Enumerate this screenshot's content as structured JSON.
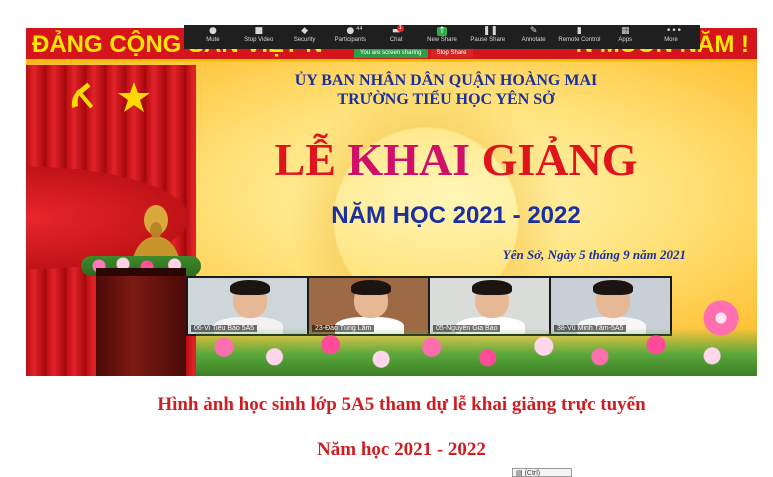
{
  "banner": {
    "slogan_left": "ĐẢNG CỘNG SẢN VIỆT N",
    "slogan_right": "N MUÔN NĂM !",
    "org": "ỦY BAN NHÂN DÂN QUẬN HOÀNG MAI",
    "school": "TRƯỜNG TIỂU HỌC YÊN SỞ",
    "title_w1": "LỄ ",
    "title_w2": "KHAI ",
    "title_w3": "GIẢNG",
    "year": "NĂM HỌC 2021 - 2022",
    "date": "Yên Sở, Ngày 5 tháng 9 năm 2021"
  },
  "zoom_toolbar": {
    "buttons": [
      {
        "label": "Mute",
        "icon": "microphone-icon",
        "glyph": "●"
      },
      {
        "label": "Stop Video",
        "icon": "video-camera-icon",
        "glyph": "■"
      },
      {
        "label": "Security",
        "icon": "shield-icon",
        "glyph": "◆"
      },
      {
        "label": "Participants",
        "icon": "people-icon",
        "glyph": "●●"
      },
      {
        "label": "Chat",
        "icon": "chat-bubble-icon",
        "glyph": "▬"
      },
      {
        "label": "New Share",
        "icon": "share-arrow-icon",
        "glyph": "↑"
      },
      {
        "label": "Pause Share",
        "icon": "pause-icon",
        "glyph": "❚❚"
      },
      {
        "label": "Annotate",
        "icon": "pencil-icon",
        "glyph": "✎"
      },
      {
        "label": "Remote Control",
        "icon": "mouse-icon",
        "glyph": "▮"
      },
      {
        "label": "Apps",
        "icon": "apps-icon",
        "glyph": "▦"
      },
      {
        "label": "More",
        "icon": "more-dots-icon",
        "glyph": "•••"
      }
    ],
    "participants_count": "44",
    "chat_badge": "1",
    "sharing_status": "You are screen sharing",
    "stop_share": "Stop Share"
  },
  "video_tiles": [
    {
      "name": "06-Vi Tiểu Bảo 5A5",
      "bg": "#cfd6d9",
      "shirt": "#f2f2f2"
    },
    {
      "name": "23-Đào Tùng Lâm",
      "bg": "#9e6a45",
      "shirt": "#ffffff"
    },
    {
      "name": "05-Nguyễn Gia Bảo",
      "bg": "#d9dcd8",
      "shirt": "#ffffff"
    },
    {
      "name": "38-Vũ Minh Tâm-5A5",
      "bg": "#c8cfd6",
      "shirt": "#f6f6f6"
    }
  ],
  "captions": {
    "line1": "Hình ảnh học sinh lớp 5A5 tham dự lễ khai giảng trực tuyến",
    "line2": "Năm học 2021 - 2022"
  },
  "paste_options": {
    "label": "(Ctrl)"
  },
  "colors": {
    "slogan_bg": "#d6141c",
    "slogan_text": "#ffe600",
    "heading_blue": "#1b2f9e",
    "title_red": "#e0141c",
    "caption_red": "#cf1d22",
    "toolbar_bg": "#1f1f1f"
  }
}
